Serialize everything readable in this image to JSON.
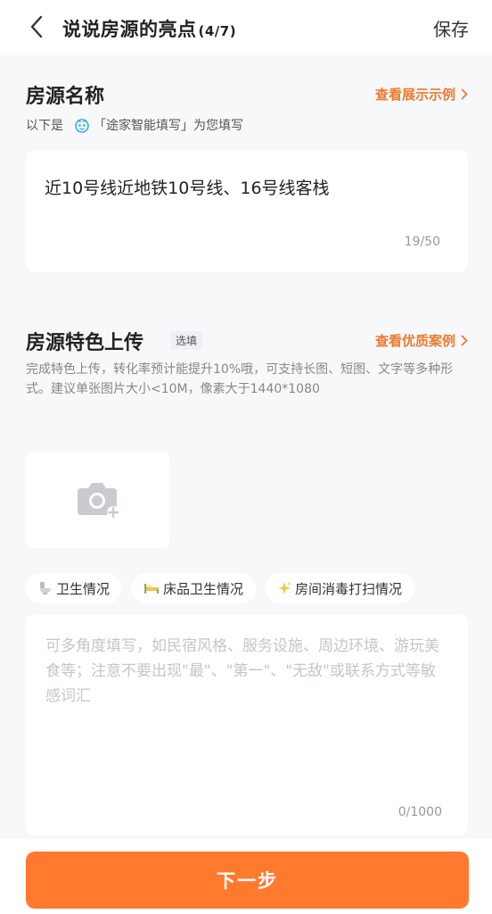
{
  "header": {
    "title": "说说房源的亮点",
    "step": "(4/7)",
    "save_label": "保存"
  },
  "name_section": {
    "title": "房源名称",
    "example_link": "查看展示示例",
    "hint_prefix": "以下是",
    "hint_suffix": "「途家智能填写」为您填写",
    "value": "近10号线近地铁10号线、16号线客栈",
    "counter": "19/50"
  },
  "feature_section": {
    "title": "房源特色上传",
    "optional_label": "选填",
    "example_link": "查看优质案例",
    "description": "完成特色上传，转化率预计能提升10%哦，可支持长图、短图、文字等多种形式。建议单张图片大小<10M，像素大于1440*1080",
    "chips": [
      {
        "icon": "toilet-icon",
        "label": "卫生情况"
      },
      {
        "icon": "bed-icon",
        "label": "床品卫生情况"
      },
      {
        "icon": "sparkle-icon",
        "label": "房间消毒打扫情况"
      }
    ],
    "placeholder": "可多角度填写，如民宿风格、服务设施、周边环境、游玩美食等；注意不要出现\"最\"、\"第一\"、\"无敌\"或联系方式等敏感词汇",
    "counter": "0/1000"
  },
  "footer": {
    "next_label": "下一步"
  },
  "colors": {
    "accent": "#ff7a2e",
    "link": "#ee7a2f",
    "background": "#f7f8fa"
  }
}
